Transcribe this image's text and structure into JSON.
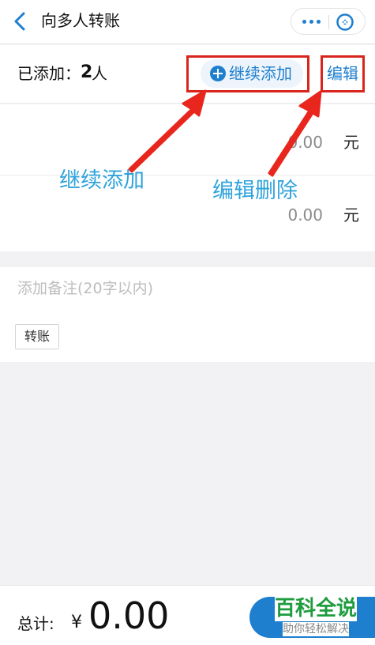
{
  "nav": {
    "title": "向多人转账",
    "icons": {
      "back": "chevron-left-icon",
      "more": "more-dots-icon",
      "close": "close-circle-icon"
    }
  },
  "summary": {
    "added_label": "已添加：",
    "count": "2",
    "unit": "人",
    "add_more_label": "继续添加",
    "edit_label": "编辑"
  },
  "recipients": [
    {
      "amount": "0.00",
      "unit": "元"
    },
    {
      "amount": "0.00",
      "unit": "元"
    }
  ],
  "note": {
    "placeholder": "添加备注(20字以内)",
    "tag": "转账"
  },
  "annotations": {
    "add_more": "继续添加",
    "edit_delete": "编辑删除"
  },
  "footer": {
    "total_label": "总计:",
    "currency": "¥",
    "total_amount": "0.00"
  },
  "watermark": {
    "title": "百科全说",
    "subtitle": "助你轻松解决"
  },
  "colors": {
    "accent": "#1e7fcf",
    "highlight": "#d9251d",
    "annotation": "#2ea3dc",
    "watermark": "#1f9c3e"
  }
}
